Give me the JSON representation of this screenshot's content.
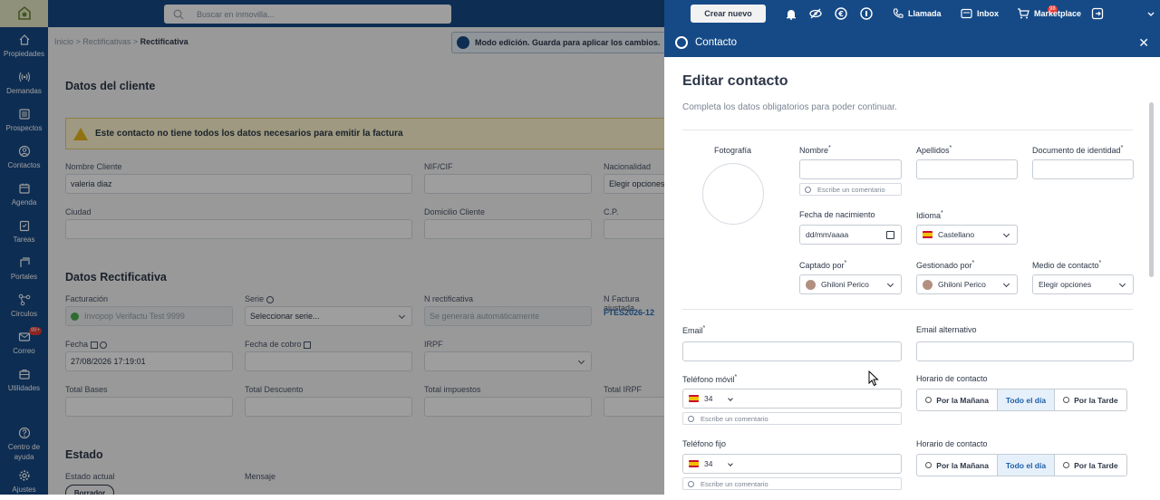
{
  "sidebar": {
    "items": [
      {
        "label": "Propiedades",
        "icon": "home-icon"
      },
      {
        "label": "Demandas",
        "icon": "signal-icon"
      },
      {
        "label": "Prospectos",
        "icon": "list-icon"
      },
      {
        "label": "Contactos",
        "icon": "user-icon"
      },
      {
        "label": "Agenda",
        "icon": "calendar-icon"
      },
      {
        "label": "Tareas",
        "icon": "clipboard-icon"
      },
      {
        "label": "Portales",
        "icon": "portal-icon"
      },
      {
        "label": "Circulos",
        "icon": "nodes-icon"
      },
      {
        "label": "Correo",
        "icon": "mail-icon",
        "badge": "99+"
      },
      {
        "label": "Utilidades",
        "icon": "toolbox-icon"
      },
      {
        "label": "Centro de ayuda",
        "icon": "help-icon"
      },
      {
        "label": "Ajustes",
        "icon": "gear-icon"
      }
    ]
  },
  "topbar": {
    "search_placeholder": "Buscar en inmovilla...",
    "new_button": "Crear nuevo",
    "llamada": "Llamada",
    "inbox": "Inbox",
    "inbox_badge": "98",
    "marketplace": "Marketplace"
  },
  "main": {
    "breadcrumb": {
      "home": "Inicio",
      "sep": ">",
      "section": "Rectificativas",
      "current": "Rectificativa"
    },
    "edit_mode": "Modo edición. Guarda para aplicar los cambios.",
    "client_section": "Datos del cliente",
    "warning": "Este contacto no tiene todos los datos necesarios para emitir la factura",
    "fields": {
      "nombre_cliente_label": "Nombre Cliente",
      "nombre_cliente_value": "valeria diaz",
      "nif_label": "NIF/CIF",
      "nacionalidad_label": "Nacionalidad",
      "nacionalidad_value": "Elegir opciones",
      "ciudad_label": "Ciudad",
      "domicilio_label": "Domicilio Cliente",
      "cp_label": "C.P."
    },
    "rect_section": "Datos Rectificativa",
    "rect": {
      "facturacion_label": "Facturación",
      "facturacion_value": "Invopop Verifactu Test 9999",
      "serie_label": "Serie",
      "serie_value": "Seleccionar serie...",
      "nrect_label": "N rectificativa",
      "nrect_value": "Se generará automáticamente",
      "nfactura_label": "N Factura ajustada",
      "nfactura_value": "FTES2026-12",
      "fecha_label": "Fecha",
      "fecha_value": "27/08/2026 17:19:01",
      "fecha_cobro_label": "Fecha de cobro",
      "irpf_label": "IRPF",
      "total_bases": "Total Bases",
      "total_descuento": "Total Descuento",
      "total_impuestos": "Total impuestos",
      "total_irpf": "Total IRPF"
    },
    "estado_section": "Estado",
    "estado_actual_label": "Estado actual",
    "estado_actual_value": "Borrador",
    "mensaje_label": "Mensaje"
  },
  "panel": {
    "header": "Contacto",
    "title": "Editar contacto",
    "subtitle": "Completa los datos obligatorios para poder continuar.",
    "photo_label": "Fotografía",
    "nombre": "Nombre",
    "apellidos": "Apellidos",
    "documento": "Documento de identidad",
    "comment_placeholder": "Escribe un comentario",
    "fecha_nac": "Fecha de nacimiento",
    "fecha_nac_placeholder": "dd/mm/aaaa",
    "idioma": "Idioma",
    "idioma_value": "Castellano",
    "captado": "Captado por",
    "captado_value": "Ghiloni Perico",
    "gestionado": "Gestionado por",
    "gestionado_value": "Ghiloni Perico",
    "medio": "Medio de contacto",
    "medio_value": "Elegir opciones",
    "email": "Email",
    "email_alt": "Email alternativo",
    "movil": "Teléfono móvil",
    "fijo": "Teléfono fijo",
    "prefix": "34",
    "horario": "Horario de contacto",
    "manana": "Por la Mañana",
    "todo": "Todo el día",
    "tarde": "Por la Tarde"
  },
  "colors": {
    "brand": "#164a87",
    "warning": "#fff7cf",
    "active_segment": "#e6f0fa"
  }
}
